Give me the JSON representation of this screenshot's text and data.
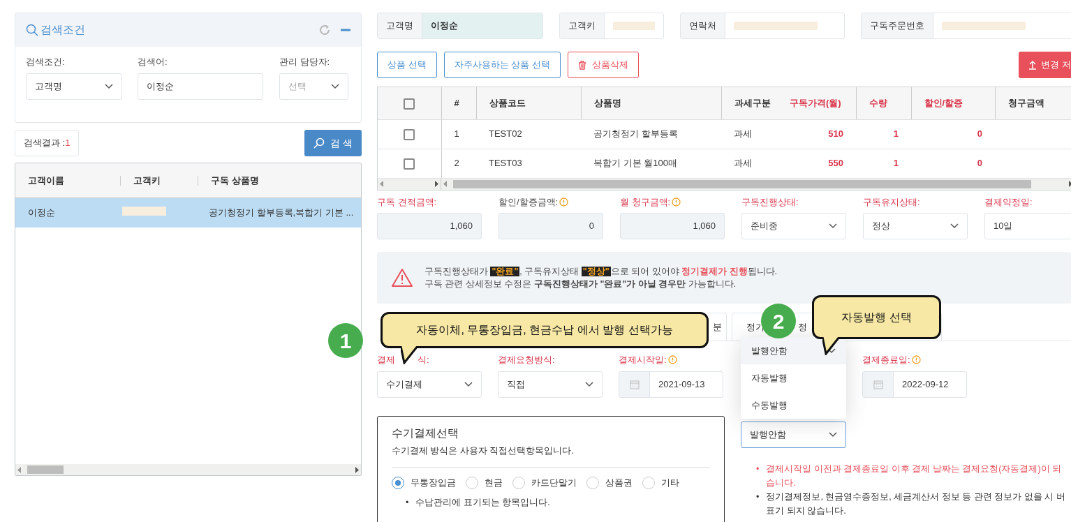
{
  "search_panel": {
    "title": "검색조건",
    "fields": [
      {
        "kind": "select",
        "label": "검색조건:",
        "value": "고객명"
      },
      {
        "kind": "input",
        "label": "검색어:",
        "value": "이정순"
      },
      {
        "kind": "select",
        "label": "관리 담당자:",
        "placeholder": "선택"
      }
    ]
  },
  "result": {
    "label": "검색결과 :",
    "count": "1"
  },
  "search_button": "검 색",
  "customer_grid": {
    "columns": [
      "고객이름",
      "고객키",
      "구독 상품명"
    ],
    "rows": [
      {
        "name": "이정순",
        "key_masked": true,
        "product": "공기청정기 할부등록,복합기 기본 ...",
        "selected": true
      }
    ]
  },
  "customer_info": [
    {
      "label": "고객명",
      "value": "이정순"
    },
    {
      "label": "고객키",
      "masked": true
    },
    {
      "label": "연락처",
      "masked": true
    },
    {
      "label": "구독주문번호",
      "masked": true
    }
  ],
  "product_buttons": [
    {
      "kind": "outline",
      "label": "상품 선택"
    },
    {
      "kind": "outline",
      "label": "자주사용하는 상품 선택"
    },
    {
      "kind": "delete",
      "label": "상품삭제"
    }
  ],
  "save_button": "변경 저",
  "product_table": {
    "all_checked": false,
    "columns": [
      {
        "label": "#",
        "required": false
      },
      {
        "label": "상품코드",
        "required": false
      },
      {
        "label": "상품명",
        "required": false
      },
      {
        "label": "과세구분",
        "required": false
      },
      {
        "label": "구독가격(월)",
        "required": true
      },
      {
        "label": "수량",
        "required": true
      },
      {
        "label": "할인/할증",
        "required": true
      },
      {
        "label": "청구금액",
        "required": false
      }
    ],
    "rows": [
      {
        "checked": false,
        "cells": [
          "1",
          "TEST02",
          "공기청정기 할부등록",
          "과세",
          "510",
          "1",
          "0"
        ]
      },
      {
        "checked": false,
        "cells": [
          "2",
          "TEST03",
          "복합기 기본 월100매",
          "과세",
          "550",
          "1",
          "0"
        ]
      }
    ]
  },
  "amounts": [
    {
      "label": "구독 견적금액:",
      "required": true,
      "info": false,
      "kind": "readonly",
      "value": "1,060"
    },
    {
      "label": "할인/할증금액:",
      "required": false,
      "info": true,
      "kind": "readonly",
      "value": "0"
    },
    {
      "label": "월 청구금액:",
      "required": true,
      "info": true,
      "kind": "readonly",
      "value": "1,060"
    },
    {
      "label": "구독진행상태:",
      "required": true,
      "info": false,
      "kind": "select",
      "value": "준비중"
    },
    {
      "label": "구독유지상태:",
      "required": true,
      "info": false,
      "kind": "select",
      "value": "정상"
    },
    {
      "label": "결제약정일:",
      "required": true,
      "info": false,
      "kind": "text",
      "value": "10일"
    }
  ],
  "notice": {
    "lines": [
      [
        {
          "kind": "plain",
          "text": "구독진행상태가 "
        },
        {
          "kind": "tag",
          "text": "\"완료\""
        },
        {
          "kind": "plain",
          "text": ", 구독유지상태 "
        },
        {
          "kind": "tag",
          "text": "\"정상\""
        },
        {
          "kind": "plain",
          "text": "으로 되어 있어야 "
        },
        {
          "kind": "alert",
          "text": "정기결제가 진행"
        },
        {
          "kind": "plain",
          "text": "됩니다."
        }
      ],
      [
        {
          "kind": "rich",
          "text": "구독 관련 상세정보 수정은 **구독진행상태가 \"완료\"가 아닐 경우만** 가능합니다."
        }
      ]
    ]
  },
  "tabs": [
    {
      "label_parts": [
        "분"
      ]
    },
    {
      "label_parts": [
        "정기",
        "정"
      ]
    }
  ],
  "payment_fields": [
    {
      "label_parts": [
        "결제",
        "식:"
      ],
      "required": true,
      "info": false,
      "kind": "select",
      "value": "수기결제"
    },
    {
      "label_parts": [
        "결제요청방식:"
      ],
      "required": true,
      "info": false,
      "kind": "select",
      "value": "직접"
    },
    {
      "label_parts": [
        "결제시작일:"
      ],
      "required": true,
      "info": true,
      "kind": "date",
      "value": "2021-09-13"
    }
  ],
  "issue_select": {
    "value": "발행안함",
    "menu": [
      {
        "label": "발행안함",
        "selected": true
      },
      {
        "label": "자동발행",
        "selected": false
      },
      {
        "label": "수동발행",
        "selected": false
      }
    ]
  },
  "end_date": {
    "label": "결제종료일:",
    "required": true,
    "info": true,
    "value": "2022-09-12"
  },
  "manual_box": {
    "title": "수기결제선택",
    "description": "수기결제 방식은 사용자 직접선택항목입니다.",
    "options": [
      {
        "label": "무통장입금",
        "selected": true
      },
      {
        "label": "현금",
        "selected": false
      },
      {
        "label": "카드단말기",
        "selected": false
      },
      {
        "label": "상품권",
        "selected": false
      },
      {
        "label": "기타",
        "selected": false
      }
    ],
    "note_bullet": "•",
    "note": "수납관리에 표기되는 항목입니다."
  },
  "notes": [
    {
      "kind": "warning",
      "bullet": "•",
      "lines": [
        "결제시작일 이전과 결제종료일 이후 결제 날짜는 결제요청(자동결제)이 되",
        "습니다."
      ]
    },
    {
      "kind": "info",
      "bullet": "•",
      "lines": [
        "정기결제정보, 현금영수증정보, 세금계산서 정보 등 관련 정보가 없을 시 버",
        "표기 되지 않습니다."
      ]
    }
  ],
  "callouts": [
    {
      "badge": "1",
      "text": "자동이체, 무통장입금, 현금수납 에서 발행 선택가능"
    },
    {
      "badge": "2",
      "text": "자동발행 선택"
    }
  ]
}
